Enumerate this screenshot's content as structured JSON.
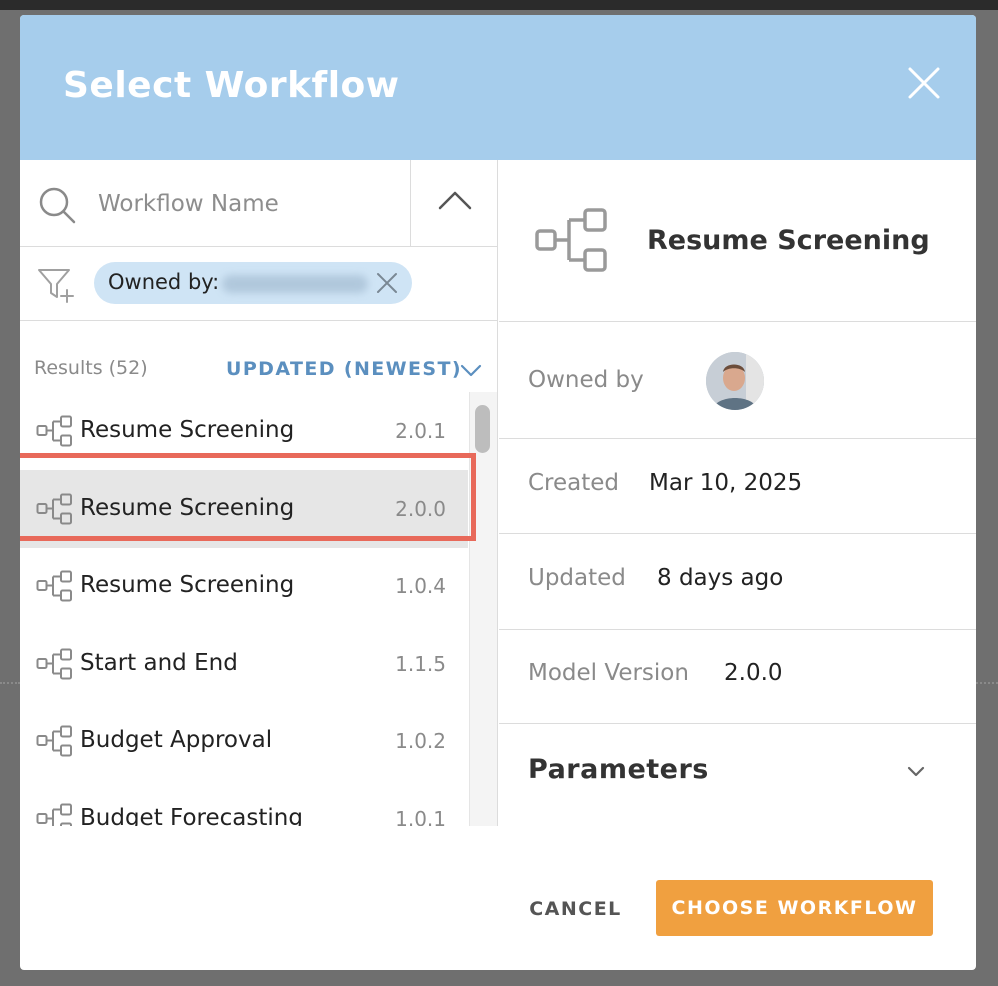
{
  "modal": {
    "title": "Select Workflow",
    "close_icon": "close-icon"
  },
  "search": {
    "placeholder": "Workflow Name",
    "value": ""
  },
  "filter": {
    "chip_label": "Owned by:"
  },
  "results": {
    "count_label": "Results (52)",
    "sort_label": "UPDATED (NEWEST)",
    "items": [
      {
        "name": "Resume Screening",
        "version": "2.0.1",
        "selected": false
      },
      {
        "name": "Resume Screening",
        "version": "2.0.0",
        "selected": true
      },
      {
        "name": "Resume Screening",
        "version": "1.0.4",
        "selected": false
      },
      {
        "name": "Start and End",
        "version": "1.1.5",
        "selected": false
      },
      {
        "name": "Budget Approval",
        "version": "1.0.2",
        "selected": false
      },
      {
        "name": "Budget Forecasting",
        "version": "1.0.1",
        "selected": false
      }
    ]
  },
  "detail": {
    "title": "Resume Screening",
    "owned_by_label": "Owned by",
    "created_label": "Created",
    "created_value": "Mar 10, 2025",
    "updated_label": "Updated",
    "updated_value": "8 days ago",
    "model_version_label": "Model Version",
    "model_version_value": "2.0.0",
    "parameters_label": "Parameters"
  },
  "footer": {
    "cancel_label": "CANCEL",
    "choose_label": "CHOOSE WORKFLOW"
  },
  "colors": {
    "header_bg": "#a6cdec",
    "accent": "#5b8fbf",
    "primary_button": "#f0a040",
    "highlight": "#e8695a"
  }
}
